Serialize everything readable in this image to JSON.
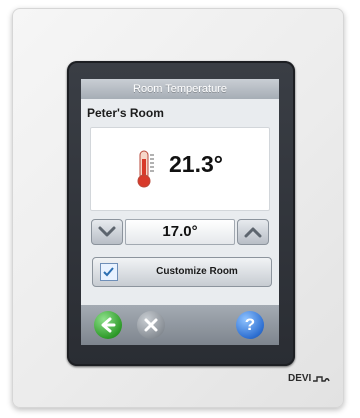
{
  "screen": {
    "title": "Room Temperature",
    "room_name": "Peter's Room",
    "current_temperature": "21.3°",
    "setpoint": "17.0°",
    "customize_label": "Customize Room"
  },
  "footer": {
    "back_icon": "arrow-left-icon",
    "cancel_icon": "close-icon",
    "help_icon": "help-icon",
    "help_label": "?"
  },
  "brand": {
    "name": "DEVI"
  },
  "colors": {
    "bezel": "#2f3238",
    "back_button": "#2f9b2a",
    "help_button": "#2e6fd1",
    "thermometer": "#d83a2a"
  }
}
